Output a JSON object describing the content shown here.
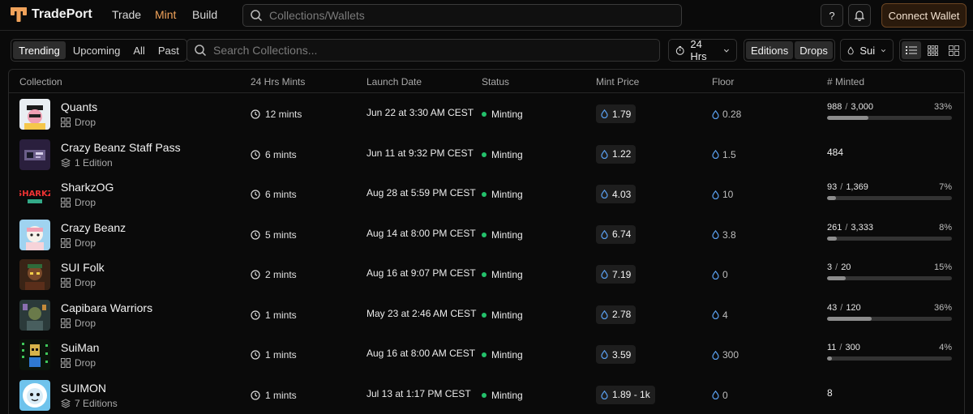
{
  "app": {
    "name": "TradePort",
    "nav": [
      "Trade",
      "Mint",
      "Build"
    ],
    "active_nav": "Mint",
    "search_placeholder": "Collections/Wallets",
    "help_label": "?",
    "connect_label": "Connect Wallet",
    "accent_color": "#f0a25a"
  },
  "filters": {
    "tabs": [
      "Trending",
      "Upcoming",
      "All",
      "Past"
    ],
    "active_tab": "Trending",
    "search_placeholder": "Search Collections...",
    "timeframe": "24 Hrs",
    "type_buttons": [
      "Editions",
      "Drops"
    ],
    "chain": "Sui",
    "view_modes": [
      "list-icon",
      "grid-icon",
      "grid-small-icon"
    ],
    "active_view": "list-icon"
  },
  "table": {
    "headers": {
      "collection": "Collection",
      "mints": "24 Hrs Mints",
      "launch": "Launch Date",
      "status": "Status",
      "price": "Mint Price",
      "floor": "Floor",
      "minted": "# Minted"
    },
    "rows": [
      {
        "name": "Quants",
        "type": "Drop",
        "type_icon": "grid-icon",
        "mints": "12 mints",
        "launch": "Jun 22 at 3:30 AM CEST",
        "status": "Minting",
        "price": "1.79",
        "floor": "0.28",
        "minted": "988",
        "supply": "3,000",
        "pct": "33%",
        "fill": 0.33
      },
      {
        "name": "Crazy Beanz Staff Pass",
        "type": "1 Edition",
        "type_icon": "layers-icon",
        "mints": "6 mints",
        "launch": "Jun 11 at 9:32 PM CEST",
        "status": "Minting",
        "price": "1.22",
        "floor": "1.5",
        "minted": "484"
      },
      {
        "name": "SharkzOG",
        "type": "Drop",
        "type_icon": "grid-icon",
        "mints": "6 mints",
        "launch": "Aug 28 at 5:59 PM CEST",
        "status": "Minting",
        "price": "4.03",
        "floor": "10",
        "minted": "93",
        "supply": "1,369",
        "pct": "7%",
        "fill": 0.07
      },
      {
        "name": "Crazy Beanz",
        "type": "Drop",
        "type_icon": "grid-icon",
        "mints": "5 mints",
        "launch": "Aug 14 at 8:00 PM CEST",
        "status": "Minting",
        "price": "6.74",
        "floor": "3.8",
        "minted": "261",
        "supply": "3,333",
        "pct": "8%",
        "fill": 0.08
      },
      {
        "name": "SUI Folk",
        "type": "Drop",
        "type_icon": "grid-icon",
        "mints": "2 mints",
        "launch": "Aug 16 at 9:07 PM CEST",
        "status": "Minting",
        "price": "7.19",
        "floor": "0",
        "minted": "3",
        "supply": "20",
        "pct": "15%",
        "fill": 0.15
      },
      {
        "name": "Capibara Warriors",
        "type": "Drop",
        "type_icon": "grid-icon",
        "mints": "1 mints",
        "launch": "May 23 at 2:46 AM CEST",
        "status": "Minting",
        "price": "2.78",
        "floor": "4",
        "minted": "43",
        "supply": "120",
        "pct": "36%",
        "fill": 0.36
      },
      {
        "name": "SuiMan",
        "type": "Drop",
        "type_icon": "grid-icon",
        "mints": "1 mints",
        "launch": "Aug 16 at 8:00 AM CEST",
        "status": "Minting",
        "price": "3.59",
        "floor": "300",
        "minted": "11",
        "supply": "300",
        "pct": "4%",
        "fill": 0.04
      },
      {
        "name": "SUIMON",
        "type": "7 Editions",
        "type_icon": "layers-icon",
        "mints": "1 mints",
        "launch": "Jul 13 at 1:17 PM CEST",
        "status": "Minting",
        "price": "1.89 - 1k",
        "floor": "0",
        "minted": "8"
      }
    ]
  }
}
